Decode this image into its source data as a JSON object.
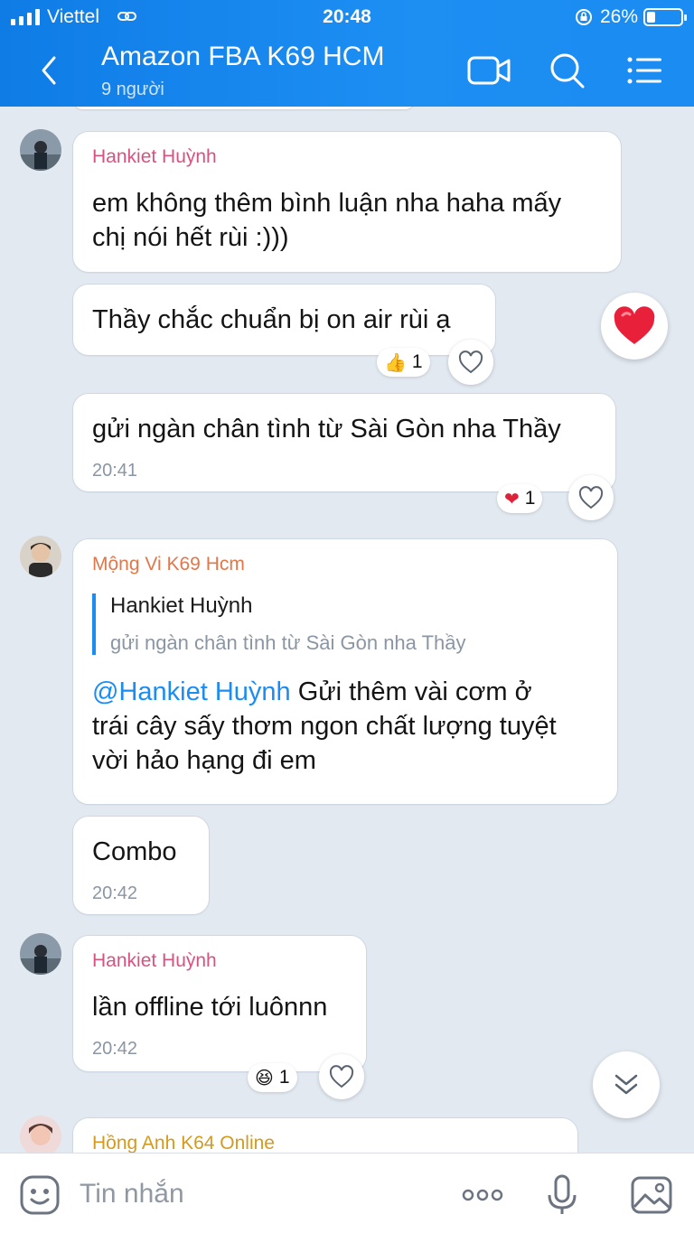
{
  "status_bar": {
    "carrier": "Viettel",
    "time": "20:48",
    "battery": "26%"
  },
  "header": {
    "title": "Amazon FBA K69 HCM",
    "subtitle": "9 người"
  },
  "messages": [
    {
      "sender": "Hankiet Huỳnh",
      "lines": [
        "em không thêm bình luận nha haha mấy",
        "chị nói hết rùi :)))"
      ]
    },
    {
      "lines": [
        "Thầy chắc chuẩn bị on air rùi ạ"
      ],
      "reaction": {
        "emoji": "👍",
        "count": "1"
      }
    },
    {
      "lines": [
        "gửi ngàn chân tình từ Sài Gòn nha Thầy"
      ],
      "time": "20:41",
      "reaction": {
        "emoji": "❤",
        "count": "1"
      }
    },
    {
      "sender": "Mộng Vi K69 Hcm",
      "quote": {
        "name": "Hankiet Huỳnh",
        "text": "gửi ngàn chân tình từ Sài Gòn nha Thầy"
      },
      "mention": "@Hankiet Huỳnh",
      "lines": [
        " Gửi thêm vài cơm ở",
        "trái cây sấy thơm ngon chất lượng tuyệt",
        "vời hảo hạng đi em"
      ]
    },
    {
      "lines": [
        "Combo"
      ],
      "time": "20:42"
    },
    {
      "sender": "Hankiet Huỳnh",
      "lines": [
        "lần offline tới luônnn"
      ],
      "time": "20:42",
      "reaction": {
        "emoji": "😆",
        "count": "1"
      }
    },
    {
      "sender": "Hồng Anh K64 Online"
    }
  ],
  "composer": {
    "placeholder": "Tin nhắn"
  },
  "icons": {
    "back": "chevron-left-icon",
    "video": "video-camera-icon",
    "search": "search-icon",
    "menu": "list-menu-icon",
    "sticker": "sticker-icon",
    "more": "more-dots-icon",
    "mic": "microphone-icon",
    "image": "image-icon",
    "heart_float": "heart-icon",
    "scroll": "double-chevron-down-icon"
  },
  "colors": {
    "header": "#1a8cf2",
    "chat_bg": "#e2e9f1",
    "sender_pink": "#d9527f",
    "sender_orange": "#e1774a",
    "sender_gold": "#d49a1d",
    "mention": "#1a8cf2",
    "timestamp": "#8a96a3"
  }
}
